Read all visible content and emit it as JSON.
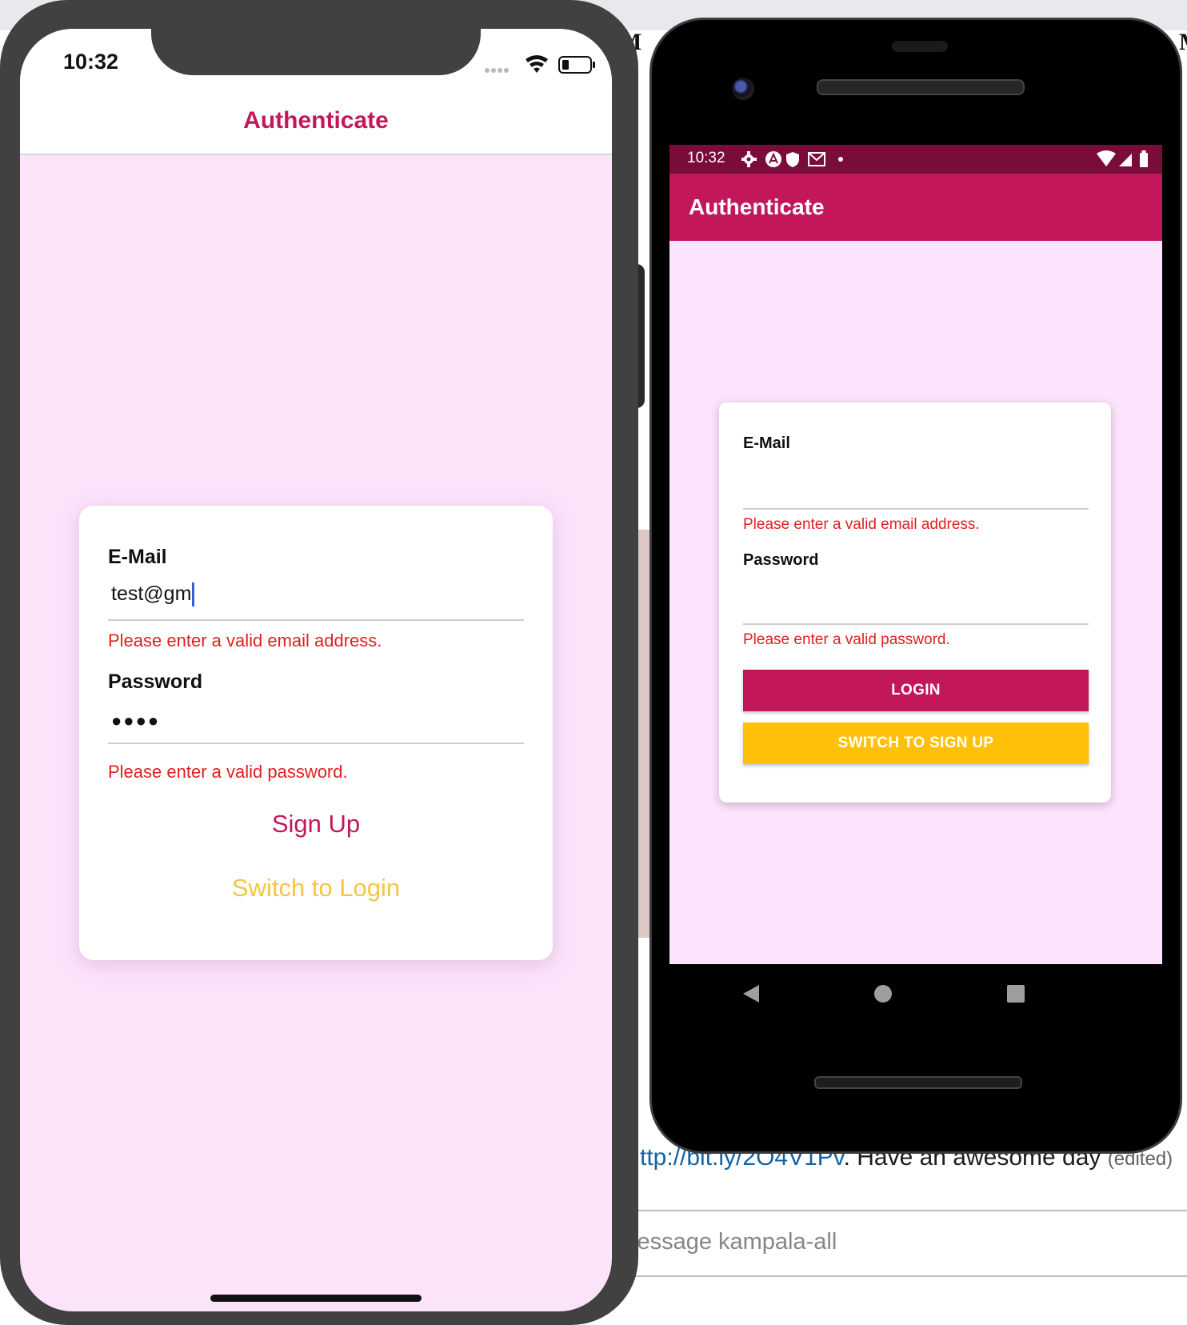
{
  "background": {
    "link_text": "ttp://bit.ly/2O4V1Pv",
    "message_text": ". Have an awesome day",
    "edited_text": "(edited)",
    "compose_placeholder": "lessage kampala-all"
  },
  "ios": {
    "status": {
      "time": "10:32"
    },
    "header": {
      "title": "Authenticate"
    },
    "form": {
      "email_label": "E-Mail",
      "email_value": "test@gm",
      "email_error": "Please enter a valid email address.",
      "password_label": "Password",
      "password_value": "●●●●",
      "password_error": "Please enter a valid password.",
      "primary_button": "Sign Up",
      "switch_button": "Switch to Login"
    },
    "colors": {
      "primary": "#c2185b",
      "secondary": "#f5c542",
      "error": "#e02020",
      "background": "#fbe3fa"
    }
  },
  "android": {
    "status": {
      "time": "10:32"
    },
    "toolbar": {
      "title": "Authenticate"
    },
    "form": {
      "email_label": "E-Mail",
      "email_value": "",
      "email_error": "Please enter a valid email address.",
      "password_label": "Password",
      "password_value": "",
      "password_error": "Please enter a valid password.",
      "primary_button": "LOGIN",
      "switch_button": "SWITCH TO SIGN UP"
    },
    "colors": {
      "primary": "#c2185b",
      "secondary": "#ffc107",
      "statusbar": "#7a0c3a",
      "background": "#fde4fd"
    },
    "nav_icons": [
      "back-icon",
      "home-icon",
      "recents-icon"
    ]
  }
}
